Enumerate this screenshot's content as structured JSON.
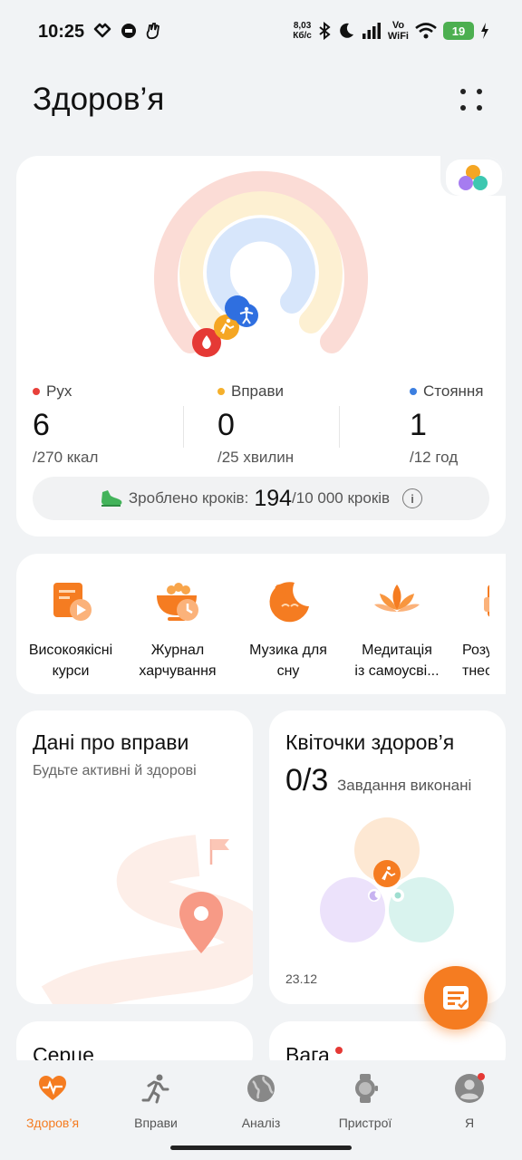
{
  "status_bar": {
    "time": "10:25",
    "net_speed_value": "8,03",
    "net_speed_unit": "Кб/с",
    "wifi_label_top": "Vo",
    "wifi_label_bottom": "WiFi",
    "battery": "19",
    "left_icons": [
      "heart-icon",
      "message-icon",
      "hand-icon"
    ],
    "right_icons": [
      "bluetooth-icon",
      "moon-icon",
      "signal-icon",
      "wifi-icon",
      "battery-icon",
      "charging-icon"
    ]
  },
  "header": {
    "title": "Здоров’я"
  },
  "activity": {
    "colors": {
      "move": "#e8403a",
      "exercise": "#f5b02c",
      "stand": "#3c7fe0"
    },
    "move": {
      "label": "Рух",
      "value": "6",
      "goal": "/270 ккал"
    },
    "exercise": {
      "label": "Вправи",
      "value": "0",
      "goal": "/25 хвилин"
    },
    "stand": {
      "label": "Стояння",
      "value": "1",
      "goal": "/12 год"
    },
    "steps": {
      "label": "Зроблено кроків:",
      "count": "194",
      "goal": "/10 000 кроків"
    }
  },
  "services": [
    {
      "label_line1": "Високоякісні",
      "label_line2": "курси",
      "icon": "video-course-icon"
    },
    {
      "label_line1": "Журнал",
      "label_line2": "харчування",
      "icon": "food-log-icon"
    },
    {
      "label_line1": "Музика для",
      "label_line2": "сну",
      "icon": "sleep-music-icon"
    },
    {
      "label_line1": "Медитація",
      "label_line2": "із самоусві...",
      "icon": "lotus-icon"
    },
    {
      "label_line1": "Розум",
      "label_line2": "тнес-г",
      "icon": "smart-fitness-icon"
    }
  ],
  "exercise_tile": {
    "title": "Дані про вправи",
    "subtitle": "Будьте активні й здорові"
  },
  "flowers_tile": {
    "title": "Квіточки здоров’я",
    "count": "0/3",
    "subtitle": "Завдання виконані",
    "date": "23.12"
  },
  "heart_tile": {
    "title": "Серце"
  },
  "weight_tile": {
    "title": "Вага"
  },
  "bottom_nav": [
    {
      "label": "Здоров’я",
      "icon": "health-heart-icon",
      "active": true
    },
    {
      "label": "Вправи",
      "icon": "running-icon",
      "active": false
    },
    {
      "label": "Аналіз",
      "icon": "globe-icon",
      "active": false
    },
    {
      "label": "Пристрої",
      "icon": "watch-icon",
      "active": false
    },
    {
      "label": "Я",
      "icon": "profile-icon",
      "active": false
    }
  ]
}
